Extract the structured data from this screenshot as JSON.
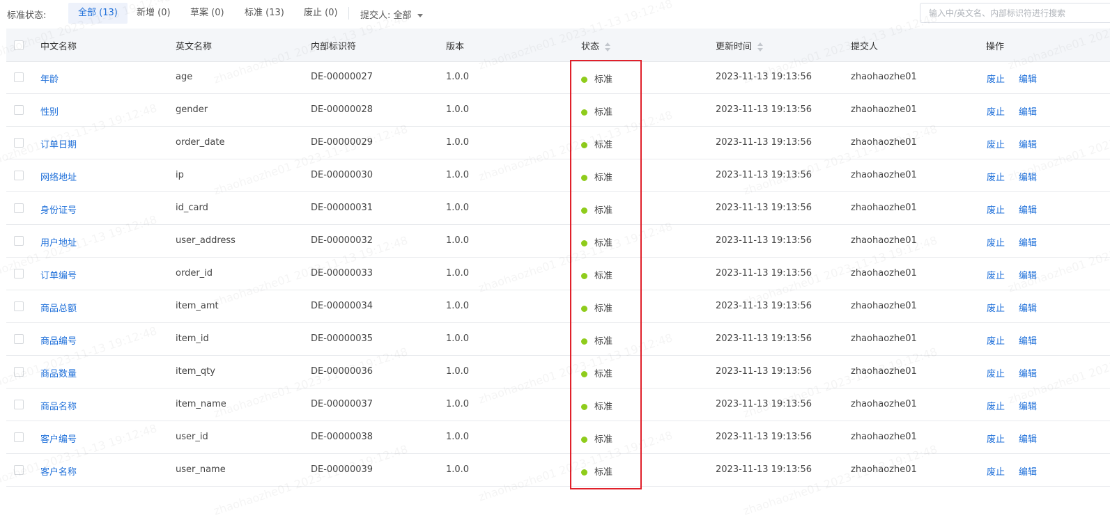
{
  "filter": {
    "label": "标准状态:",
    "chips": [
      "全部 (13)",
      "新增 (0)",
      "草案 (0)",
      "标准 (13)",
      "废止 (0)"
    ],
    "submitter_label": "提交人: 全部",
    "search_placeholder": "输入中/英文名、内部标识符进行搜索"
  },
  "table": {
    "columns": [
      "中文名称",
      "英文名称",
      "内部标识符",
      "版本",
      "状态",
      "更新时间",
      "提交人",
      "操作"
    ],
    "rows": [
      {
        "cn": "年龄",
        "en": "age",
        "id": "DE-00000027",
        "version": "1.0.0",
        "status": "标准",
        "updated": "2023-11-13 19:13:56",
        "submitter": "zhaohaozhe01"
      },
      {
        "cn": "性别",
        "en": "gender",
        "id": "DE-00000028",
        "version": "1.0.0",
        "status": "标准",
        "updated": "2023-11-13 19:13:56",
        "submitter": "zhaohaozhe01"
      },
      {
        "cn": "订单日期",
        "en": "order_date",
        "id": "DE-00000029",
        "version": "1.0.0",
        "status": "标准",
        "updated": "2023-11-13 19:13:56",
        "submitter": "zhaohaozhe01"
      },
      {
        "cn": "网络地址",
        "en": "ip",
        "id": "DE-00000030",
        "version": "1.0.0",
        "status": "标准",
        "updated": "2023-11-13 19:13:56",
        "submitter": "zhaohaozhe01"
      },
      {
        "cn": "身份证号",
        "en": "id_card",
        "id": "DE-00000031",
        "version": "1.0.0",
        "status": "标准",
        "updated": "2023-11-13 19:13:56",
        "submitter": "zhaohaozhe01"
      },
      {
        "cn": "用户地址",
        "en": "user_address",
        "id": "DE-00000032",
        "version": "1.0.0",
        "status": "标准",
        "updated": "2023-11-13 19:13:56",
        "submitter": "zhaohaozhe01"
      },
      {
        "cn": "订单编号",
        "en": "order_id",
        "id": "DE-00000033",
        "version": "1.0.0",
        "status": "标准",
        "updated": "2023-11-13 19:13:56",
        "submitter": "zhaohaozhe01"
      },
      {
        "cn": "商品总额",
        "en": "item_amt",
        "id": "DE-00000034",
        "version": "1.0.0",
        "status": "标准",
        "updated": "2023-11-13 19:13:56",
        "submitter": "zhaohaozhe01"
      },
      {
        "cn": "商品编号",
        "en": "item_id",
        "id": "DE-00000035",
        "version": "1.0.0",
        "status": "标准",
        "updated": "2023-11-13 19:13:56",
        "submitter": "zhaohaozhe01"
      },
      {
        "cn": "商品数量",
        "en": "item_qty",
        "id": "DE-00000036",
        "version": "1.0.0",
        "status": "标准",
        "updated": "2023-11-13 19:13:56",
        "submitter": "zhaohaozhe01"
      },
      {
        "cn": "商品名称",
        "en": "item_name",
        "id": "DE-00000037",
        "version": "1.0.0",
        "status": "标准",
        "updated": "2023-11-13 19:13:56",
        "submitter": "zhaohaozhe01"
      },
      {
        "cn": "客户编号",
        "en": "user_id",
        "id": "DE-00000038",
        "version": "1.0.0",
        "status": "标准",
        "updated": "2023-11-13 19:13:56",
        "submitter": "zhaohaozhe01"
      },
      {
        "cn": "客户名称",
        "en": "user_name",
        "id": "DE-00000039",
        "version": "1.0.0",
        "status": "标准",
        "updated": "2023-11-13 19:13:56",
        "submitter": "zhaohaozhe01"
      }
    ],
    "actions": [
      "废止",
      "编辑"
    ]
  },
  "watermark": "zhaohaozhe01 2023-11-13 19:12:48",
  "colors": {
    "accent": "#1e6fd9",
    "status_dot": "#8fcc1c",
    "highlight_border": "#e0202a",
    "header_bg": "#f4f6f9"
  }
}
